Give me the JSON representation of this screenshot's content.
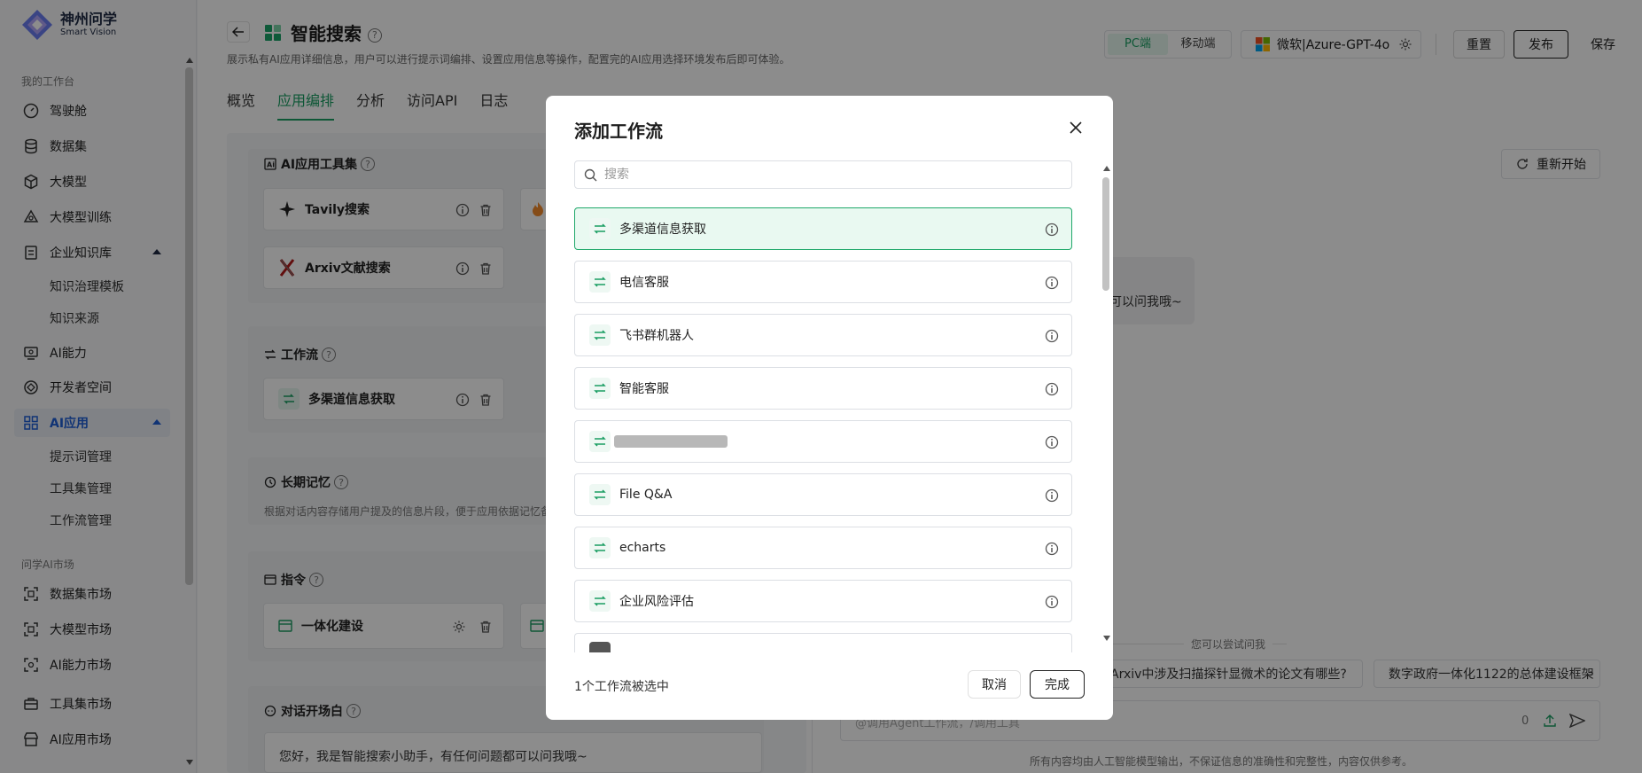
{
  "brand": {
    "name": "神州问学",
    "sub": "Smart Vision"
  },
  "sidebar": {
    "group_workspace": "我的工作台",
    "items": [
      {
        "label": "驾驶舱",
        "icon": "dashboard-icon"
      },
      {
        "label": "数据集",
        "icon": "database-icon"
      },
      {
        "label": "大模型",
        "icon": "cube-icon"
      },
      {
        "label": "大模型训练",
        "icon": "training-icon"
      },
      {
        "label": "企业知识库",
        "icon": "knowledge-icon"
      },
      {
        "label": "知识治理模板"
      },
      {
        "label": "知识来源"
      },
      {
        "label": "AI能力",
        "icon": "ai-ability-icon"
      },
      {
        "label": "开发者空间",
        "icon": "developer-icon"
      },
      {
        "label": "AI应用",
        "icon": "grid-icon"
      },
      {
        "label": "提示词管理"
      },
      {
        "label": "工具集管理"
      },
      {
        "label": "工作流管理"
      }
    ],
    "group_market": "问学AI市场",
    "market_items": [
      {
        "label": "数据集市场"
      },
      {
        "label": "大模型市场"
      },
      {
        "label": "AI能力市场"
      },
      {
        "label": "工具集市场"
      },
      {
        "label": "AI应用市场"
      }
    ]
  },
  "header": {
    "title": "智能搜索",
    "description": "展示私有AI应用详细信息，用户可以进行提示词编排、设置应用信息等操作，配置完的AI应用选择环境发布后即可体验。",
    "tabs": [
      "概览",
      "应用编排",
      "分析",
      "访问API",
      "日志"
    ],
    "platform": [
      "PC端",
      "移动端"
    ],
    "model": "微软|Azure-GPT-4o",
    "reset": "重置",
    "publish": "发布",
    "save": "保存"
  },
  "editor": {
    "toolset_title": "AI应用工具集",
    "tools": [
      "Tavily搜索",
      "Arxiv文献搜索"
    ],
    "workflow_title": "工作流",
    "workflow_item": "多渠道信息获取",
    "memory_title": "长期记忆",
    "memory_desc": "根据对话内容存储用户提及的信息片段，便于应用依据记忆备",
    "instr_title": "指令",
    "instr_item": "一体化建设",
    "opening_title": "对话开场白",
    "opening_text": "您好，我是智能搜索小助手，有任何问题都可以问我哦~"
  },
  "preview": {
    "restart": "重新开始",
    "bubble_text": "可以问我哦~",
    "try_label": "您可以尝试问我",
    "suggestions": [
      "Arxiv中涉及扫描探针显微术的论文有哪些?",
      "数字政府一体化1122的总体建设框架"
    ],
    "input_placeholder": "@调用Agent工作流，/调用工具",
    "char_count": "0",
    "disclaimer": "所有内容均由人工智能模型输出，不保证信息的准确性和完整性，内容仅供参考。"
  },
  "modal": {
    "title": "添加工作流",
    "search_placeholder": "搜索",
    "workflows": [
      "多渠道信息获取",
      "电信客服",
      "飞书群机器人",
      "智能客服",
      "",
      "File Q&A",
      "echarts",
      "企业风险评估"
    ],
    "selected_count": "1个工作流被选中",
    "cancel": "取消",
    "done": "完成"
  },
  "colors": {
    "accent": "#1a9e63",
    "nav_active": "#1f5fd6"
  }
}
